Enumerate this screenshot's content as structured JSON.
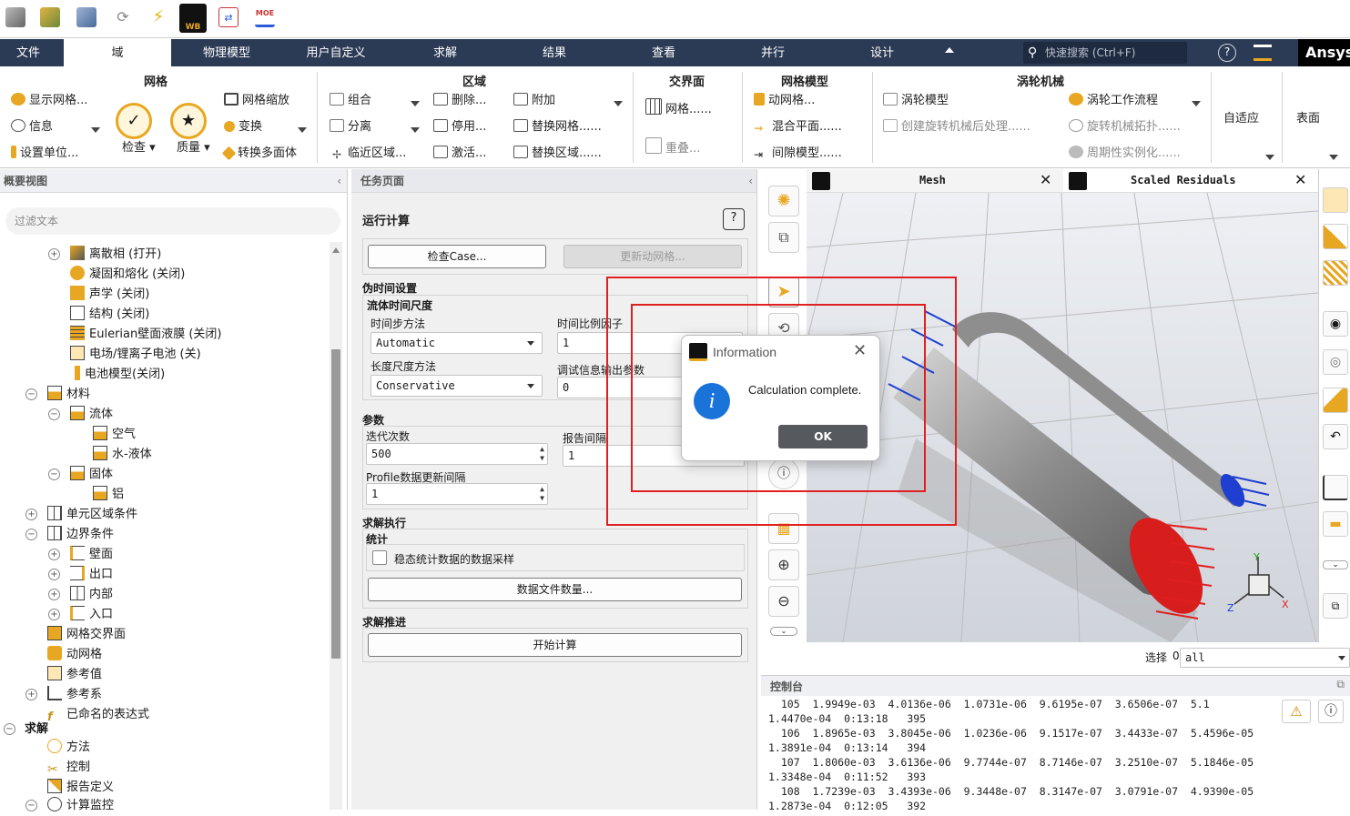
{
  "quickbar": {
    "icons": [
      "cube-gray-icon",
      "cube-color-icon",
      "cube-blue-icon",
      "refresh-icon",
      "lightning-icon",
      "wb-icon",
      "transfer-icon",
      "moe-icon"
    ],
    "wb_label": "WB",
    "moe_label": "MOE"
  },
  "menubar": {
    "tabs": [
      "文件",
      "域",
      "物理模型",
      "用户自定义",
      "求解",
      "结果",
      "查看",
      "并行",
      "设计"
    ],
    "active_tab": "域",
    "search_placeholder": "快速搜索 (Ctrl+F)",
    "brand": "Ansys"
  },
  "ribbon": {
    "mesh": {
      "title": "网格",
      "show_mesh": "显示网格...",
      "info": "信息",
      "set_units": "设置单位...",
      "check": "检查",
      "quality": "质量",
      "scale": "网格缩放",
      "transform": "变换",
      "convert_polyhedra": "转换多面体"
    },
    "zone": {
      "title": "区域",
      "combine": "组合",
      "separate": "分离",
      "adjacency": "临近区域...",
      "delete": "删除...",
      "deactivate": "停用...",
      "activate": "激活...",
      "append": "附加",
      "replace_mesh": "替换网格......",
      "replace_zone": "替换区域......"
    },
    "interface": {
      "title": "交界面",
      "mesh": "网格......",
      "overset": "重叠..."
    },
    "mesh_models": {
      "title": "网格模型",
      "dynamic_mesh": "动网格...",
      "mixing_plane": "混合平面......",
      "gap_model": "间隙模型......"
    },
    "turbo": {
      "title": "涡轮机械",
      "turbo_model": "涡轮模型",
      "turbo_post": "创建旋转机械后处理......",
      "workflow": "涡轮工作流程",
      "topology": "旋转机械拓扑......",
      "periodic": "周期性实例化......"
    },
    "adapt": {
      "title": "自适应"
    },
    "surface": {
      "title": "表面"
    }
  },
  "outline": {
    "title": "概要视图",
    "filter_placeholder": "过滤文本",
    "items": [
      "离散相 (打开)",
      "凝固和熔化 (关闭)",
      "声学 (关闭)",
      "结构 (关闭)",
      "Eulerian壁面液膜 (关闭)",
      "电场/锂离子电池 (关)",
      "电池模型(关闭)",
      "材料",
      "流体",
      "空气",
      "水-液体",
      "固体",
      "铝",
      "单元区域条件",
      "边界条件",
      "壁面",
      "出口",
      "内部",
      "入口",
      "网格交界面",
      "动网格",
      "参考值",
      "参考系",
      "已命名的表达式",
      "求解",
      "方法",
      "控制",
      "报告定义",
      "计算监控"
    ]
  },
  "task_page": {
    "title": "任务页面",
    "section": "运行计算",
    "check_case": "检查Case...",
    "update_dynamic_mesh": "更新动网格...",
    "pseudo_time": "伪时间设置",
    "fluid_time_scale": "流体时间尺度",
    "time_step_method_label": "时间步方法",
    "time_step_method": "Automatic",
    "time_scale_factor_label": "时间比例因子",
    "time_scale_factor": "1",
    "length_scale_label": "长度尺度方法",
    "length_scale": "Conservative",
    "verbosity_label": "调试信息输出参数",
    "verbosity": "0",
    "params": "参数",
    "iterations_label": "迭代次数",
    "iterations": "500",
    "report_interval_label": "报告间隔",
    "report_interval": "1",
    "profile_interval_label": "Profile数据更新间隔",
    "profile_interval": "1",
    "solution_processing": "求解执行",
    "statistics": "统计",
    "sampling_label": "稳态统计数据的数据采样",
    "data_file_quantities": "数据文件数量...",
    "solution_advancement": "求解推进",
    "calculate": "开始计算"
  },
  "graphics": {
    "tab_mesh": "Mesh",
    "tab_residuals": "Scaled Residuals",
    "select_label": "选择",
    "select_value": "all"
  },
  "dialog": {
    "title": "Information",
    "message": "Calculation complete.",
    "ok": "OK"
  },
  "console": {
    "title": "控制台",
    "lines": [
      "  105  1.9949e-03  4.0136e-06  1.0731e-06  9.6195e-07  3.6506e-07  5.1",
      "1.4470e-04  0:13:18   395",
      "  106  1.8965e-03  3.8045e-06  1.0236e-06  9.1517e-07  3.4433e-07  5.4596e-05",
      "1.3891e-04  0:13:14   394",
      "  107  1.8060e-03  3.6136e-06  9.7744e-07  8.7146e-07  3.2510e-07  5.1846e-05",
      "1.3348e-04  0:11:52   393",
      "  108  1.7239e-03  3.4393e-06  9.3448e-07  8.3147e-07  3.0791e-07  4.9390e-05",
      "1.2873e-04  0:12:05   392"
    ]
  },
  "colors": {
    "menubar_bg": "#2b3a55",
    "accent_orange": "#e7a722",
    "inlet_red": "#e02020",
    "outlet_blue": "#1f3fd0",
    "highlight_red": "#e02020"
  }
}
